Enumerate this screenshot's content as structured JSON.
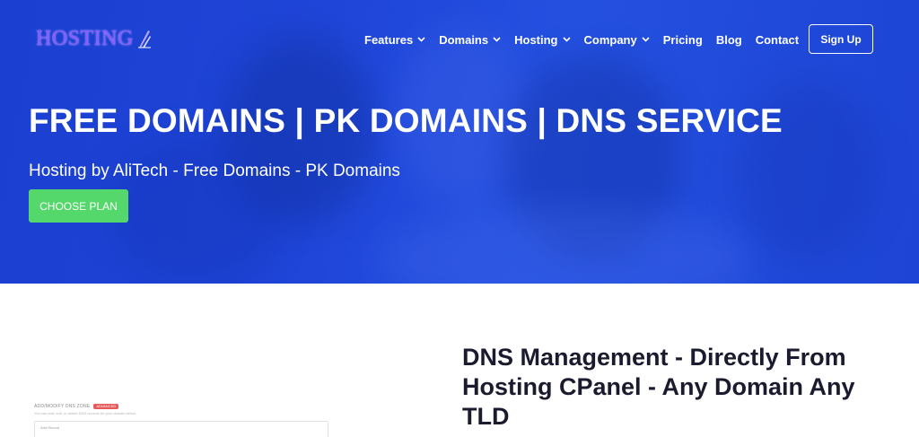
{
  "brand": {
    "logo_text": "HOSTING",
    "logo_color": "#8a5cff"
  },
  "nav": {
    "items": [
      {
        "label": "Features",
        "has_dropdown": true
      },
      {
        "label": "Domains",
        "has_dropdown": true
      },
      {
        "label": "Hosting",
        "has_dropdown": true
      },
      {
        "label": "Company",
        "has_dropdown": true
      },
      {
        "label": "Pricing",
        "has_dropdown": false
      },
      {
        "label": "Blog",
        "has_dropdown": false
      },
      {
        "label": "Contact",
        "has_dropdown": false
      }
    ],
    "signup_label": "Sign Up"
  },
  "hero": {
    "title": "FREE DOMAINS | PK DOMAINS | DNS SERVICE",
    "subtitle": "Hosting by AliTech - Free Domains - PK Domains",
    "cta_label": "CHOOSE PLAN",
    "cta_color": "#55d86b",
    "background_color": "#1f45d8"
  },
  "section": {
    "heading": "DNS Management - Directly From Hosting CPanel - Any Domain Any TLD"
  },
  "screenshot": {
    "title": "ADD/MODIFY DNS ZONE",
    "badge": "ADVANCED",
    "subtext": "You can add, edit, or delete DNS records for your domain below.",
    "box_label": "Add Record"
  }
}
